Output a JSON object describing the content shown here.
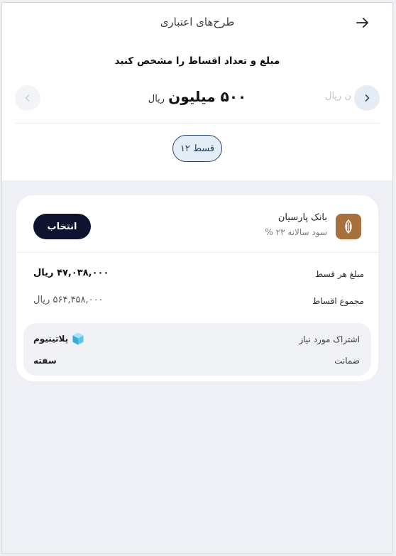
{
  "header": {
    "title": "طرح‌های اعتباری"
  },
  "selector": {
    "prompt": "مبلغ و تعداد اقساط را مشخص کنید",
    "amount_value": "۵۰۰ میلیون",
    "amount_unit": "ریال",
    "next_amount_partial": "ن ریال",
    "installments_label": "۱۲ قسط"
  },
  "plan": {
    "bank_name": "بانک پارسیان",
    "interest_text": "سود سالانه ۲۳ %",
    "select_label": "انتخاب",
    "installment_label": "مبلغ هر قسط",
    "installment_value": "۴۷,۰۳۸,۰۰۰ ریال",
    "total_label": "مجموع اقساط",
    "total_value": "۵۶۴,۴۵۸,۰۰۰ ریال",
    "subscription_label": "اشتراک مورد نیاز",
    "subscription_value": "پلاتینیوم",
    "guarantee_label": "ضمانت",
    "guarantee_value": "سفته"
  },
  "colors": {
    "accent_dark": "#0e1330",
    "pill_border": "#2b4a73",
    "bank_brand": "#a8703c"
  }
}
